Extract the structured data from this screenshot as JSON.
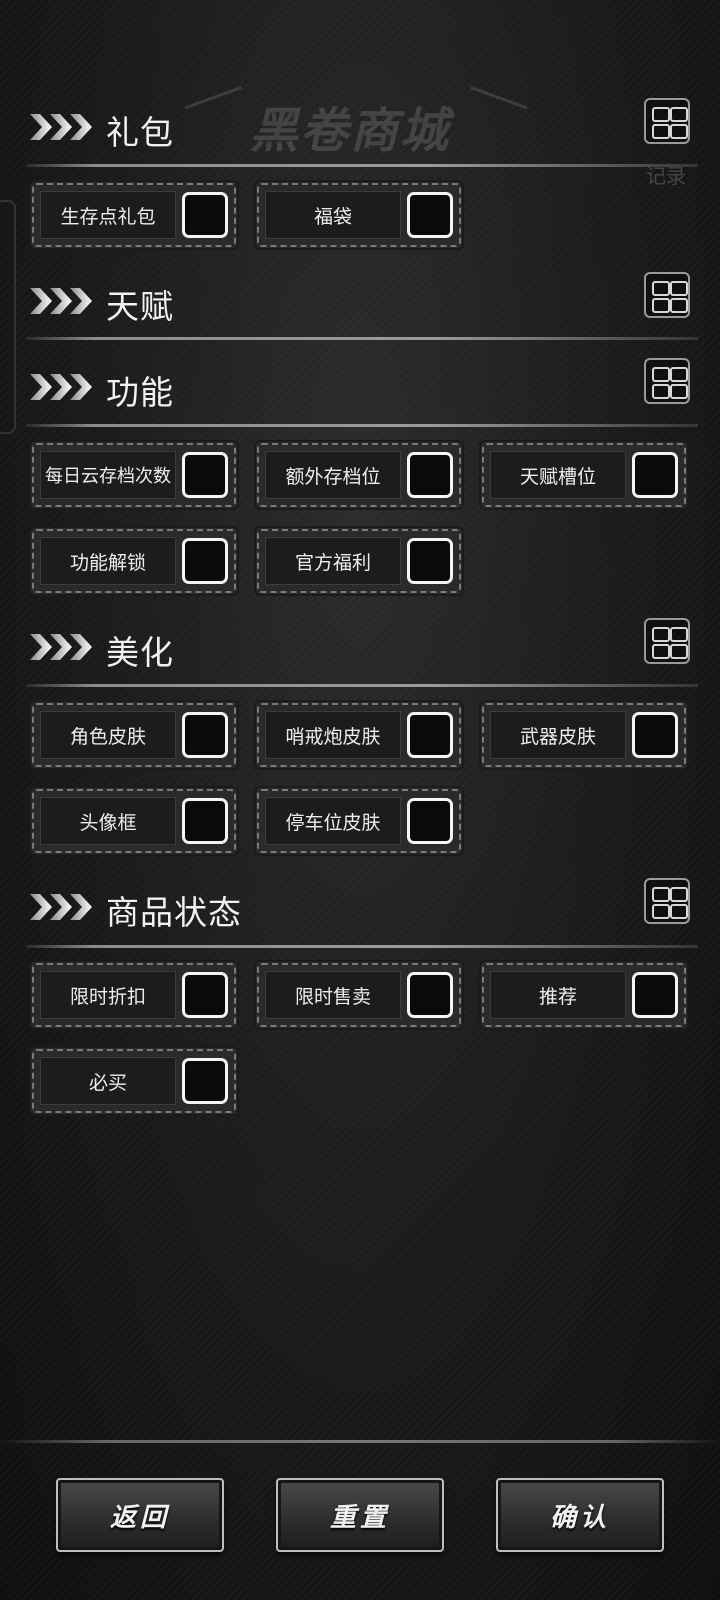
{
  "background": {
    "banner_title": "黑卷商城",
    "record_label": "记录"
  },
  "sections": [
    {
      "title": "礼包",
      "options": [
        "生存点礼包",
        "福袋"
      ]
    },
    {
      "title": "天赋",
      "options": []
    },
    {
      "title": "功能",
      "options": [
        "每日云存档次数",
        "额外存档位",
        "天赋槽位",
        "功能解锁",
        "官方福利"
      ]
    },
    {
      "title": "美化",
      "options": [
        "角色皮肤",
        "哨戒炮皮肤",
        "武器皮肤",
        "头像框",
        "停车位皮肤"
      ]
    },
    {
      "title": "商品状态",
      "options": [
        "限时折扣",
        "限时售卖",
        "推荐",
        "必买"
      ]
    }
  ],
  "footer": {
    "back_label": "返回",
    "reset_label": "重置",
    "confirm_label": "确认"
  },
  "colors": {
    "background": "#1c1c1c",
    "checkbox_border": "#f4f4f4",
    "divider": "#8c8c8c"
  },
  "icons": {
    "section_marker": "triple-chevron-icon",
    "grid_toggle": "grid-icon"
  }
}
